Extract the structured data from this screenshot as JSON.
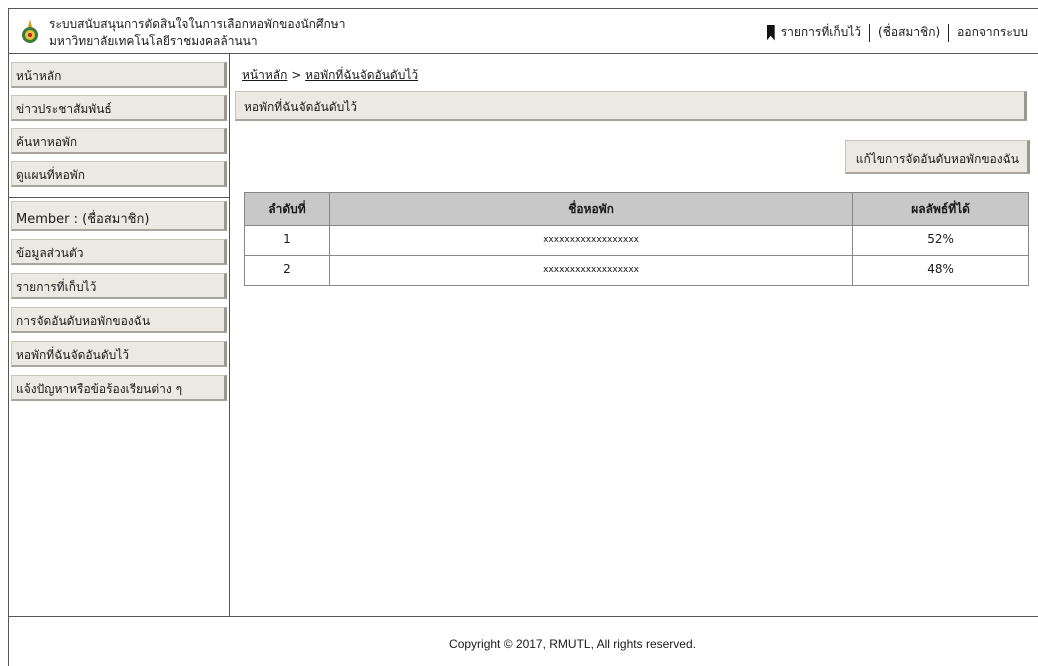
{
  "header": {
    "title_line1": "ระบบสนับสนุนการตัดสินใจในการเลือกหอพักของนักศึกษา",
    "title_line2": "มหาวิทยาลัยเทคโนโลยีราชมงคลล้านนา",
    "nav": {
      "saved": "รายการที่เก็บไว้",
      "member": "(ชื่อสมาชิก)",
      "logout": "ออกจากระบบ"
    }
  },
  "sidebar": {
    "main_items": [
      "หน้าหลัก",
      "ข่าวประชาสัมพันธ์",
      "ค้นหาหอพัก",
      "ดูแผนที่หอพัก"
    ],
    "member_label": "Member : (ชื่อสมาชิก)",
    "member_items": [
      "ข้อมูลส่วนตัว",
      "รายการที่เก็บไว้",
      "การจัดอันดับหอพักของฉัน",
      "หอพักที่ฉันจัดอันดับไว้",
      "แจ้งปัญหาหรือข้อร้องเรียนต่าง ๆ"
    ]
  },
  "breadcrumb": {
    "home": "หน้าหลัก",
    "separator": ">",
    "current": "หอพักที่ฉันจัดอันดับไว้"
  },
  "page_title": "หอพักที่ฉันจัดอันดับไว้",
  "edit_button": "แก้ไขการจัดอันดับหอพักของฉัน",
  "table": {
    "headers": [
      "ลำดับที่",
      "ชื่อหอพัก",
      "ผลลัพธ์ที่ได้"
    ],
    "rows": [
      [
        "1",
        "xxxxxxxxxxxxxxxxxx",
        "52%"
      ],
      [
        "2",
        "xxxxxxxxxxxxxxxxxx",
        "48%"
      ]
    ]
  },
  "footer": "Copyright © 2017, RMUTL, All rights reserved.",
  "colors": {
    "panel": "#ece9e3",
    "table_header": "#c8c8c8",
    "border": "#555555"
  }
}
